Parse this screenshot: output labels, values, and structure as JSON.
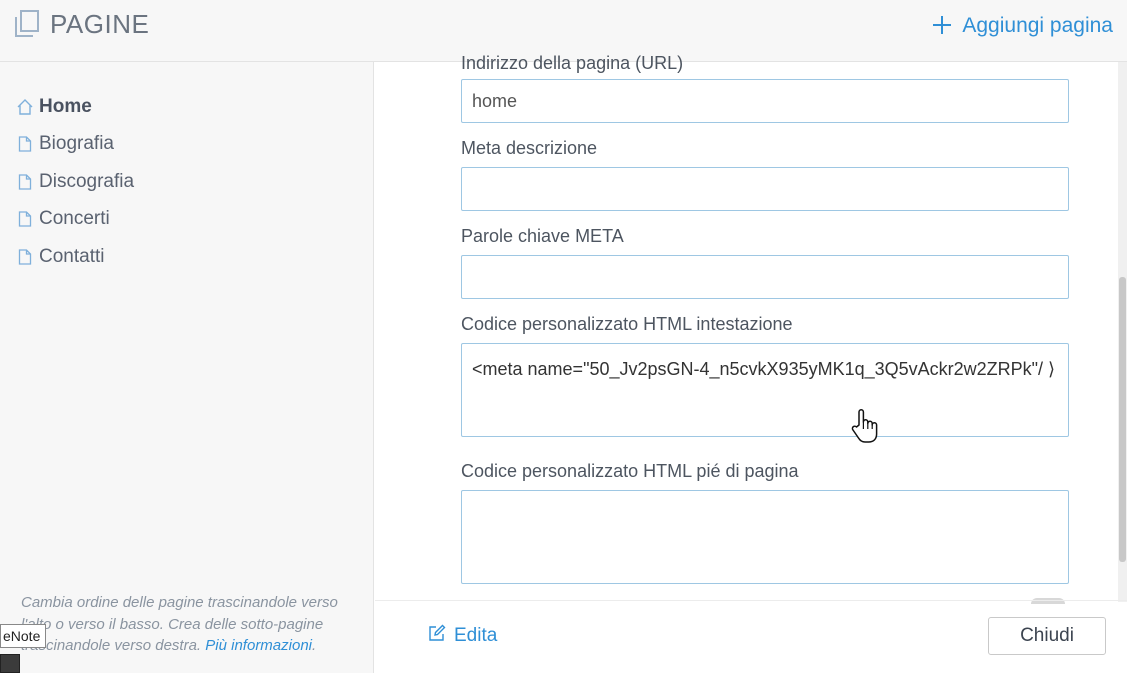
{
  "header": {
    "title": "PAGINE",
    "add_page_label": "Aggiungi pagina",
    "accent_color": "#2f8fd6"
  },
  "sidebar": {
    "items": [
      {
        "label": "Home",
        "icon": "home-icon",
        "active": true
      },
      {
        "label": "Biografia",
        "icon": "page-icon",
        "active": false
      },
      {
        "label": "Discografia",
        "icon": "page-icon",
        "active": false
      },
      {
        "label": "Concerti",
        "icon": "page-icon",
        "active": false
      },
      {
        "label": "Contatti",
        "icon": "page-icon",
        "active": false
      }
    ],
    "help_text": "Cambia ordine delle pagine trascinandole verso l'alto o verso il basso. Crea delle sotto-pagine trascinandole verso destra.",
    "help_link": "Più informazioni",
    "help_end": "."
  },
  "overlay": {
    "tooltip_text": "eNote"
  },
  "form": {
    "url_label": "Indirizzo della pagina (URL)",
    "url_value": "home",
    "meta_desc_label": "Meta descrizione",
    "meta_desc_value": "",
    "keywords_label": "Parole chiave META",
    "keywords_value": "",
    "header_code_label": "Codice personalizzato HTML intestazione",
    "header_code_value": "<meta name=\"50_Jv2psGN-4_n5cvkX935yMK1q_3Q5vAckr2w2ZRPk\"/ ⟩",
    "footer_code_label": "Codice personalizzato HTML pié di pagina",
    "footer_code_value": ""
  },
  "footer": {
    "edit_label": "Edita",
    "close_label": "Chiudi"
  }
}
